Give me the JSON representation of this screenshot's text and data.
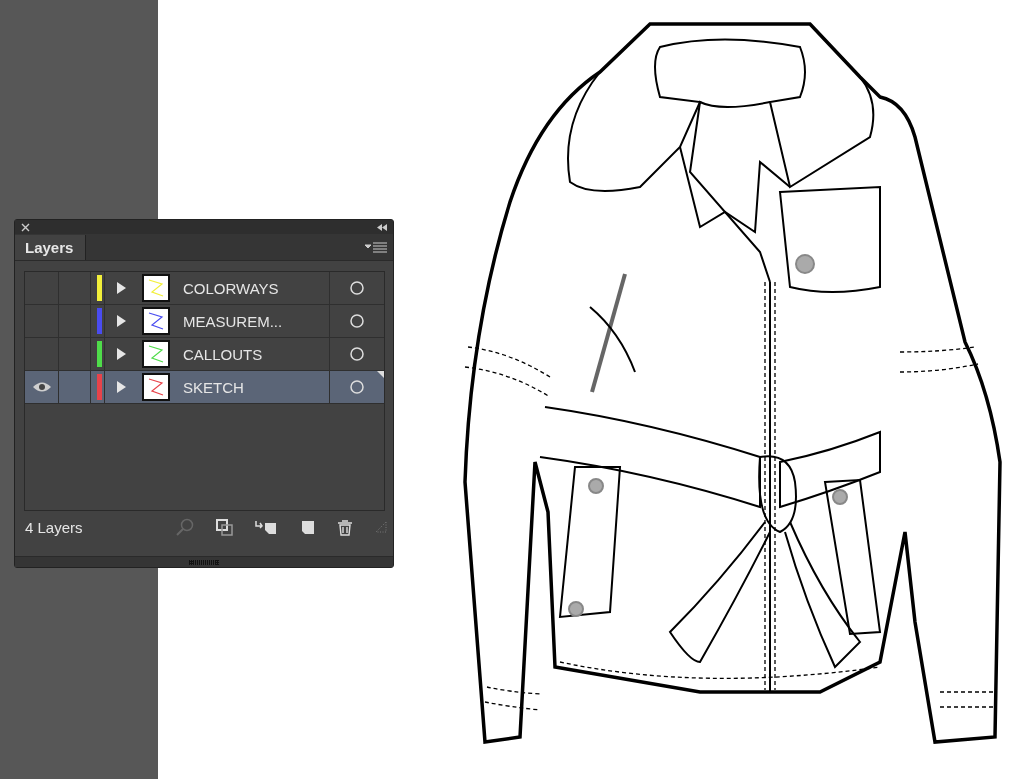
{
  "panel": {
    "tab": "Layers",
    "footer_count": "4 Layers"
  },
  "layers": [
    {
      "name": "COLORWAYS",
      "color": "#f2ef3a",
      "visible": false,
      "selected": false
    },
    {
      "name": "MEASUREM...",
      "color": "#4a4cf0",
      "visible": false,
      "selected": false
    },
    {
      "name": "CALLOUTS",
      "color": "#4fdc4a",
      "visible": false,
      "selected": false
    },
    {
      "name": "SKETCH",
      "color": "#e8434a",
      "visible": true,
      "selected": true
    }
  ]
}
